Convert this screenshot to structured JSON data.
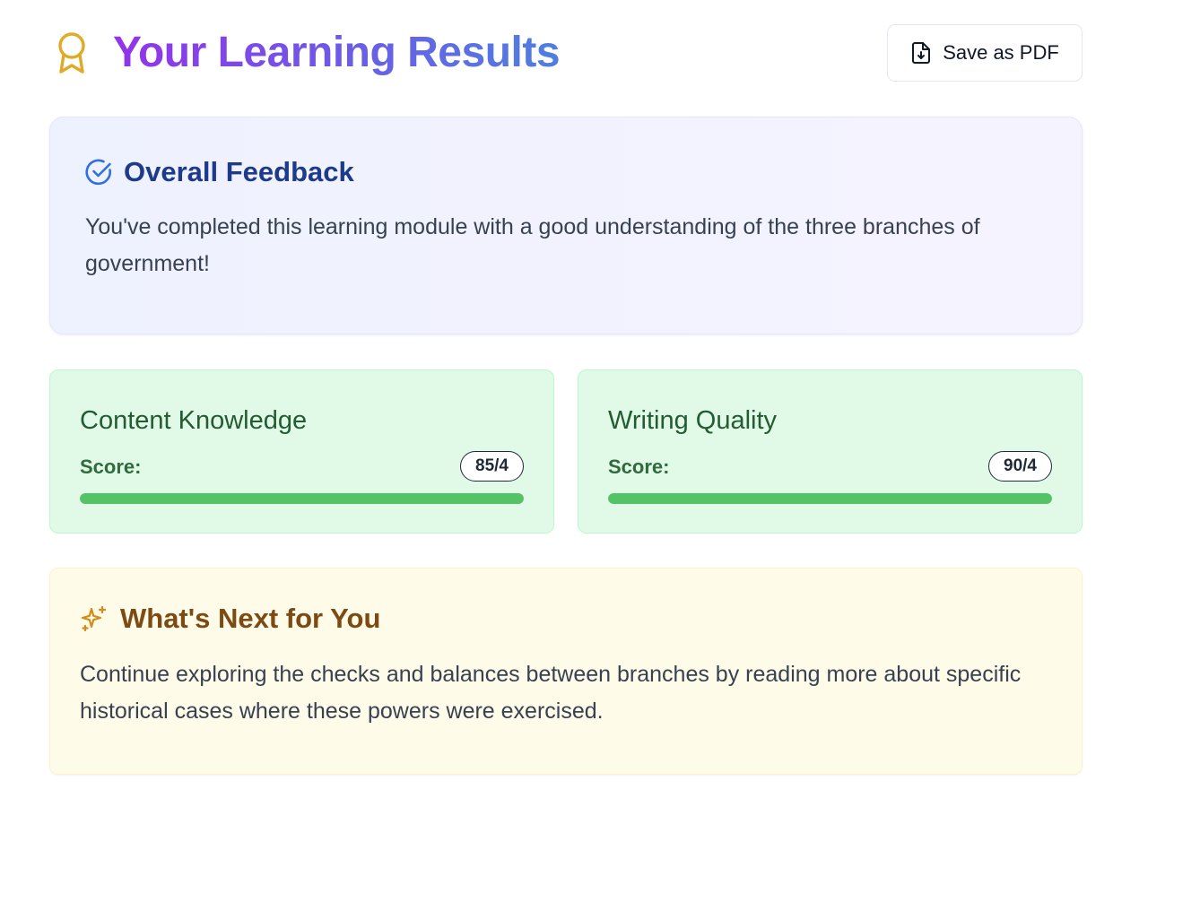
{
  "header": {
    "title": "Your Learning Results",
    "save_label": "Save as PDF"
  },
  "feedback": {
    "heading": "Overall Feedback",
    "text": "You've completed this learning module with a good understanding of the three branches of government!"
  },
  "scores": [
    {
      "title": "Content Knowledge",
      "label": "Score:",
      "value": "85/4",
      "progress": 1.0
    },
    {
      "title": "Writing Quality",
      "label": "Score:",
      "value": "90/4",
      "progress": 1.0
    }
  ],
  "next": {
    "heading": "What's Next for You",
    "text": "Continue exploring the checks and balances between branches by reading more about specific historical cases where these powers were exercised."
  },
  "icons": {
    "award": "award-icon",
    "save": "file-download-icon",
    "feedback": "check-circle-icon",
    "next": "sparkles-icon"
  },
  "colors": {
    "title_gradient_start": "#9333ea",
    "title_gradient_end": "#4f7fe0",
    "award": "#e0a928",
    "feedback_heading": "#1e3a8a",
    "score_fill": "#56c266",
    "next_heading": "#7c4a12"
  }
}
